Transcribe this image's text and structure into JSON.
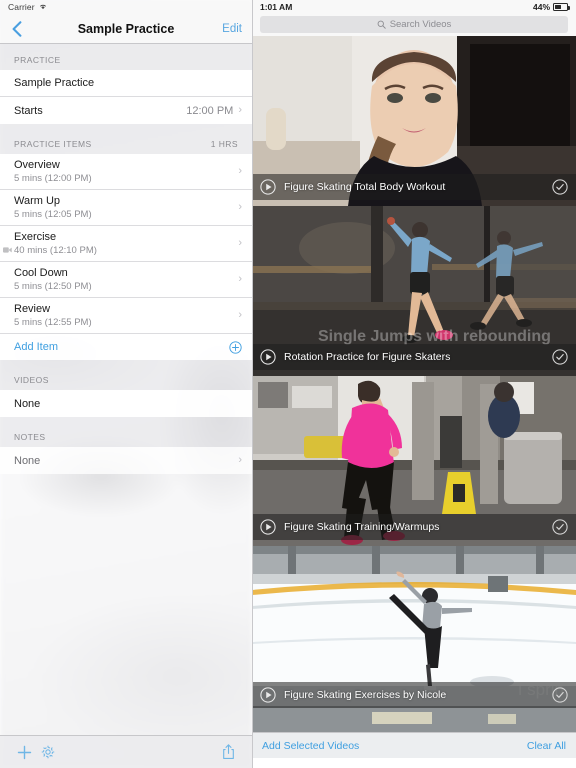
{
  "sidebar": {
    "status": {
      "carrier": "Carrier",
      "wifi_icon": "wifi-icon"
    },
    "nav": {
      "back_icon": "chevron-left-icon",
      "title": "Sample Practice",
      "edit_label": "Edit"
    },
    "sections": [
      {
        "header": "PRACTICE",
        "header_right": "",
        "rows": [
          {
            "title": "Sample Practice",
            "sub": "",
            "value": "",
            "chevron": false
          },
          {
            "title": "Starts",
            "sub": "",
            "value": "12:00 PM",
            "chevron": true
          }
        ]
      },
      {
        "header": "PRACTICE ITEMS",
        "header_right": "1 HRS",
        "rows": [
          {
            "title": "Overview",
            "sub": "5 mins (12:00 PM)",
            "value": "",
            "chevron": true,
            "cam": false
          },
          {
            "title": "Warm Up",
            "sub": "5 mins (12:05 PM)",
            "value": "",
            "chevron": true,
            "cam": false
          },
          {
            "title": "Exercise",
            "sub": "40 mins (12:10 PM)",
            "value": "",
            "chevron": true,
            "cam": true
          },
          {
            "title": "Cool Down",
            "sub": "5 mins (12:50 PM)",
            "value": "",
            "chevron": true,
            "cam": false
          },
          {
            "title": "Review",
            "sub": "5 mins (12:55 PM)",
            "value": "",
            "chevron": true,
            "cam": false
          }
        ],
        "add_label": "Add Item",
        "add_icon": "plus-circle-icon"
      },
      {
        "header": "VIDEOS",
        "header_right": "",
        "rows": [
          {
            "title": "None",
            "sub": "",
            "value": "",
            "chevron": false
          }
        ]
      },
      {
        "header": "NOTES",
        "header_right": "",
        "rows": [
          {
            "title": "None",
            "sub": "",
            "value": "",
            "chevron": true,
            "dim": true
          }
        ]
      }
    ],
    "toolbar": {
      "add_icon": "plus-icon",
      "settings_icon": "gear-icon",
      "share_icon": "share-icon"
    }
  },
  "rightpane": {
    "status": {
      "time": "1:01 AM",
      "battery_percent": "44%",
      "battery_icon": "battery-icon"
    },
    "search": {
      "placeholder": "Search Videos",
      "icon": "search-icon"
    },
    "videos": [
      {
        "title": "Figure Skating Total Body Workout",
        "play_icon": "play-circle-icon",
        "check_icon": "check-circle-icon",
        "overlay": ""
      },
      {
        "title": "Rotation Practice for Figure Skaters",
        "play_icon": "play-circle-icon",
        "check_icon": "check-circle-icon",
        "overlay": "Single Jumps with rebounding"
      },
      {
        "title": "Figure Skating Training/Warmups",
        "play_icon": "play-circle-icon",
        "check_icon": "check-circle-icon",
        "overlay": ""
      },
      {
        "title": "Figure Skating Exercises by Nicole",
        "play_icon": "play-circle-icon",
        "check_icon": "check-circle-icon",
        "overlay": "I sprin"
      }
    ],
    "bottom": {
      "add_label": "Add Selected Videos",
      "clear_label": "Clear All"
    }
  },
  "colors": {
    "tint": "#3f9fe0",
    "edit_tint": "#58a6e0",
    "section_header_text": "#8b8b90"
  }
}
